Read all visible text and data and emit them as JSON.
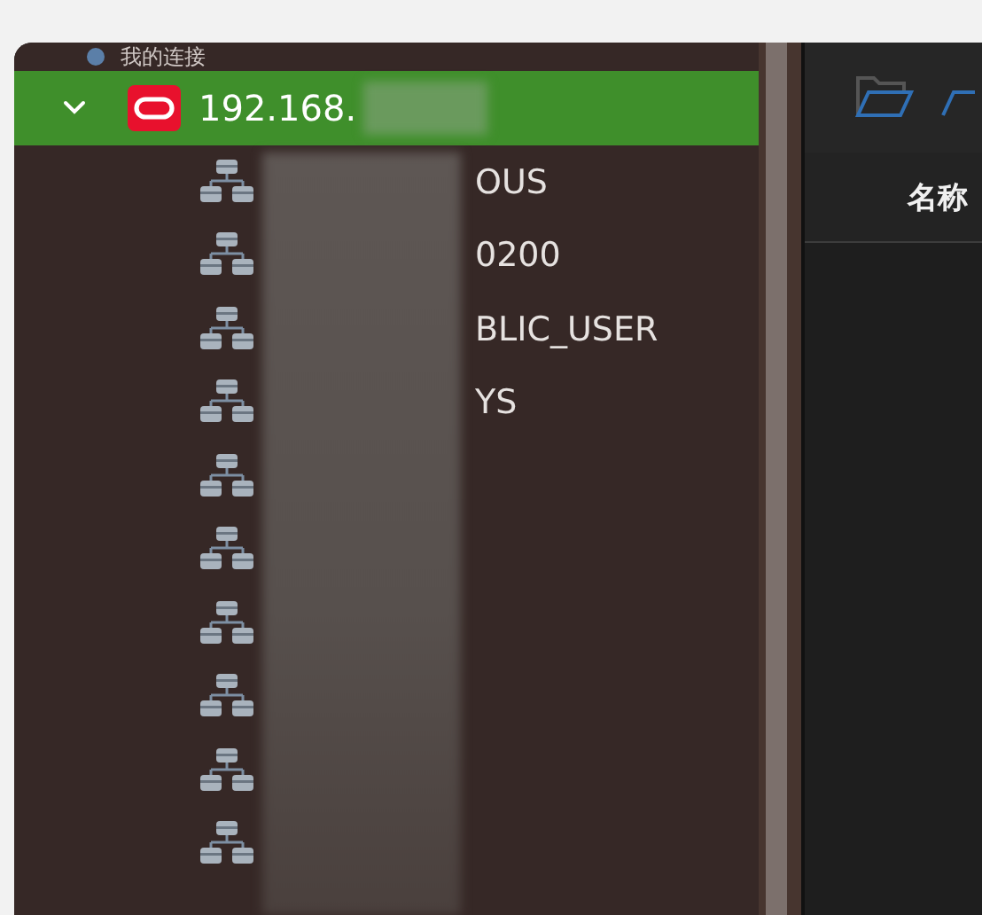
{
  "sidebar": {
    "group_label": "我的连接",
    "connection": {
      "name": "192.168.",
      "expanded": true,
      "selected": true,
      "children": [
        {
          "kind": "named",
          "name": "OUS"
        },
        {
          "kind": "named",
          "name": "0200"
        },
        {
          "kind": "named",
          "name": "BLIC_USER"
        },
        {
          "kind": "named",
          "name": "YS"
        },
        {
          "kind": "blurred"
        },
        {
          "kind": "blurred"
        },
        {
          "kind": "blurred"
        },
        {
          "kind": "blurred"
        },
        {
          "kind": "blurred"
        },
        {
          "kind": "blurred"
        }
      ]
    }
  },
  "table": {
    "columns": [
      "名称"
    ]
  }
}
